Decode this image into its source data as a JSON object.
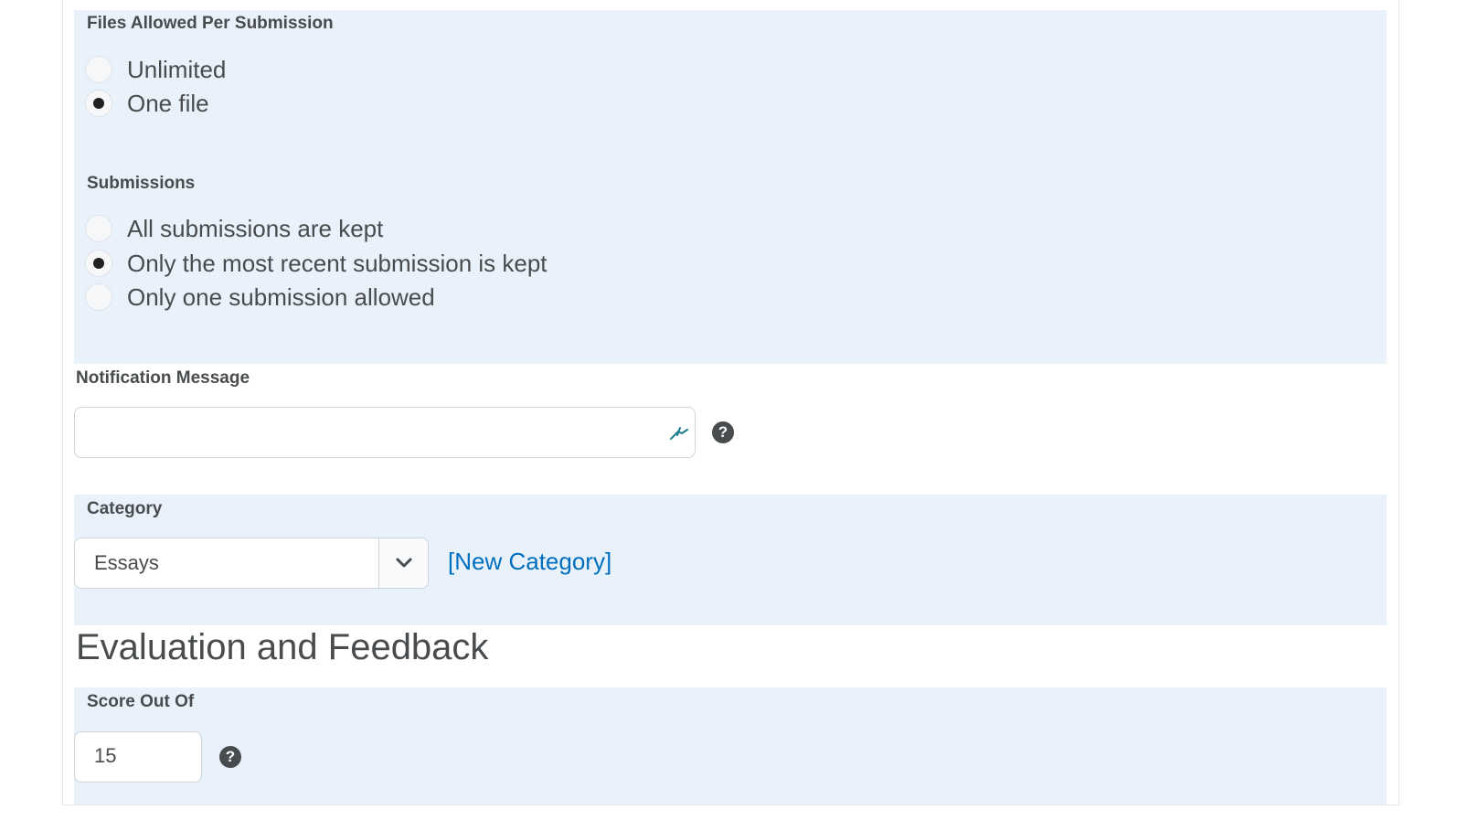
{
  "files_allowed": {
    "label": "Files Allowed Per Submission",
    "options": [
      {
        "label": "Unlimited",
        "selected": false
      },
      {
        "label": "One file",
        "selected": true
      }
    ]
  },
  "submissions": {
    "label": "Submissions",
    "options": [
      {
        "label": "All submissions are kept",
        "selected": false
      },
      {
        "label": "Only the most recent submission is kept",
        "selected": true
      },
      {
        "label": "Only one submission allowed",
        "selected": false
      }
    ]
  },
  "notification": {
    "label": "Notification Message",
    "value": "",
    "help_icon": "question-mark-icon",
    "editor_icon": "equation-editor-icon"
  },
  "category": {
    "label": "Category",
    "selected": "Essays",
    "new_link": "[New Category]"
  },
  "evaluation": {
    "heading": "Evaluation and Feedback",
    "score_label": "Score Out Of",
    "score_value": "15",
    "help_icon": "question-mark-icon"
  },
  "colors": {
    "band_background": "#e9f1fa",
    "link": "#006fbf",
    "text": "#494c4e"
  }
}
